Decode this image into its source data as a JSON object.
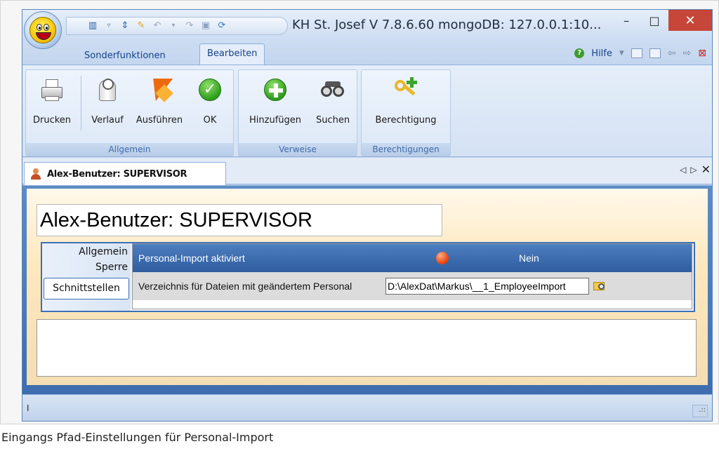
{
  "window": {
    "title": "KH St. Josef V 7.8.6.60 mongoDB: 127.0.0.1:10...",
    "minimize_glyph": "–",
    "maximize_glyph": "□",
    "close_glyph": "✕"
  },
  "quick_access": {
    "dropdown_glyph": "▿"
  },
  "ribbon": {
    "tabs": [
      "Sonderfunktionen",
      "Bearbeiten"
    ],
    "active_tab": "Bearbeiten",
    "help_label": "Hilfe",
    "groups": {
      "allgemein": {
        "label": "Allgemein",
        "buttons": [
          "Drucken",
          "Verlauf",
          "Ausführen",
          "OK"
        ]
      },
      "verweise": {
        "label": "Verweise",
        "buttons": [
          "Hinzufügen",
          "Suchen"
        ]
      },
      "berechtigungen": {
        "label": "Berechtigungen",
        "buttons": [
          "Berechtigung"
        ]
      }
    }
  },
  "document_tab": {
    "title": "Alex-Benutzer: SUPERVISOR",
    "prev_glyph": "◁",
    "next_glyph": "▷",
    "close_glyph": "✕"
  },
  "form": {
    "heading": "Alex-Benutzer: SUPERVISOR",
    "side_tabs": [
      "Allgemein",
      "Sperre",
      "Schnittstellen"
    ],
    "active_side_tab": "Schnittstellen",
    "rows": [
      {
        "label": "Personal-Import aktiviert",
        "value": "Nein",
        "status_color": "#f14a16"
      },
      {
        "label": "Verzeichnis für Dateien mit geändertem Personal",
        "value": "D:\\AlexDat\\Markus\\__1_EmployeeImport"
      }
    ]
  },
  "statusbar": {
    "text": "I",
    "grip": ".::"
  },
  "caption": "Eingangs Pfad-Einstellungen für Personal-Import",
  "icons": {
    "app": "smiley-app-icon",
    "print": "printer-icon",
    "history": "scroll-clock-icon",
    "execute": "flash-icon",
    "ok": "checkmark-icon",
    "add": "plus-icon",
    "search": "binoculars-icon",
    "permission": "keys-plus-icon",
    "user": "user-icon",
    "folder": "folder-search-icon"
  }
}
